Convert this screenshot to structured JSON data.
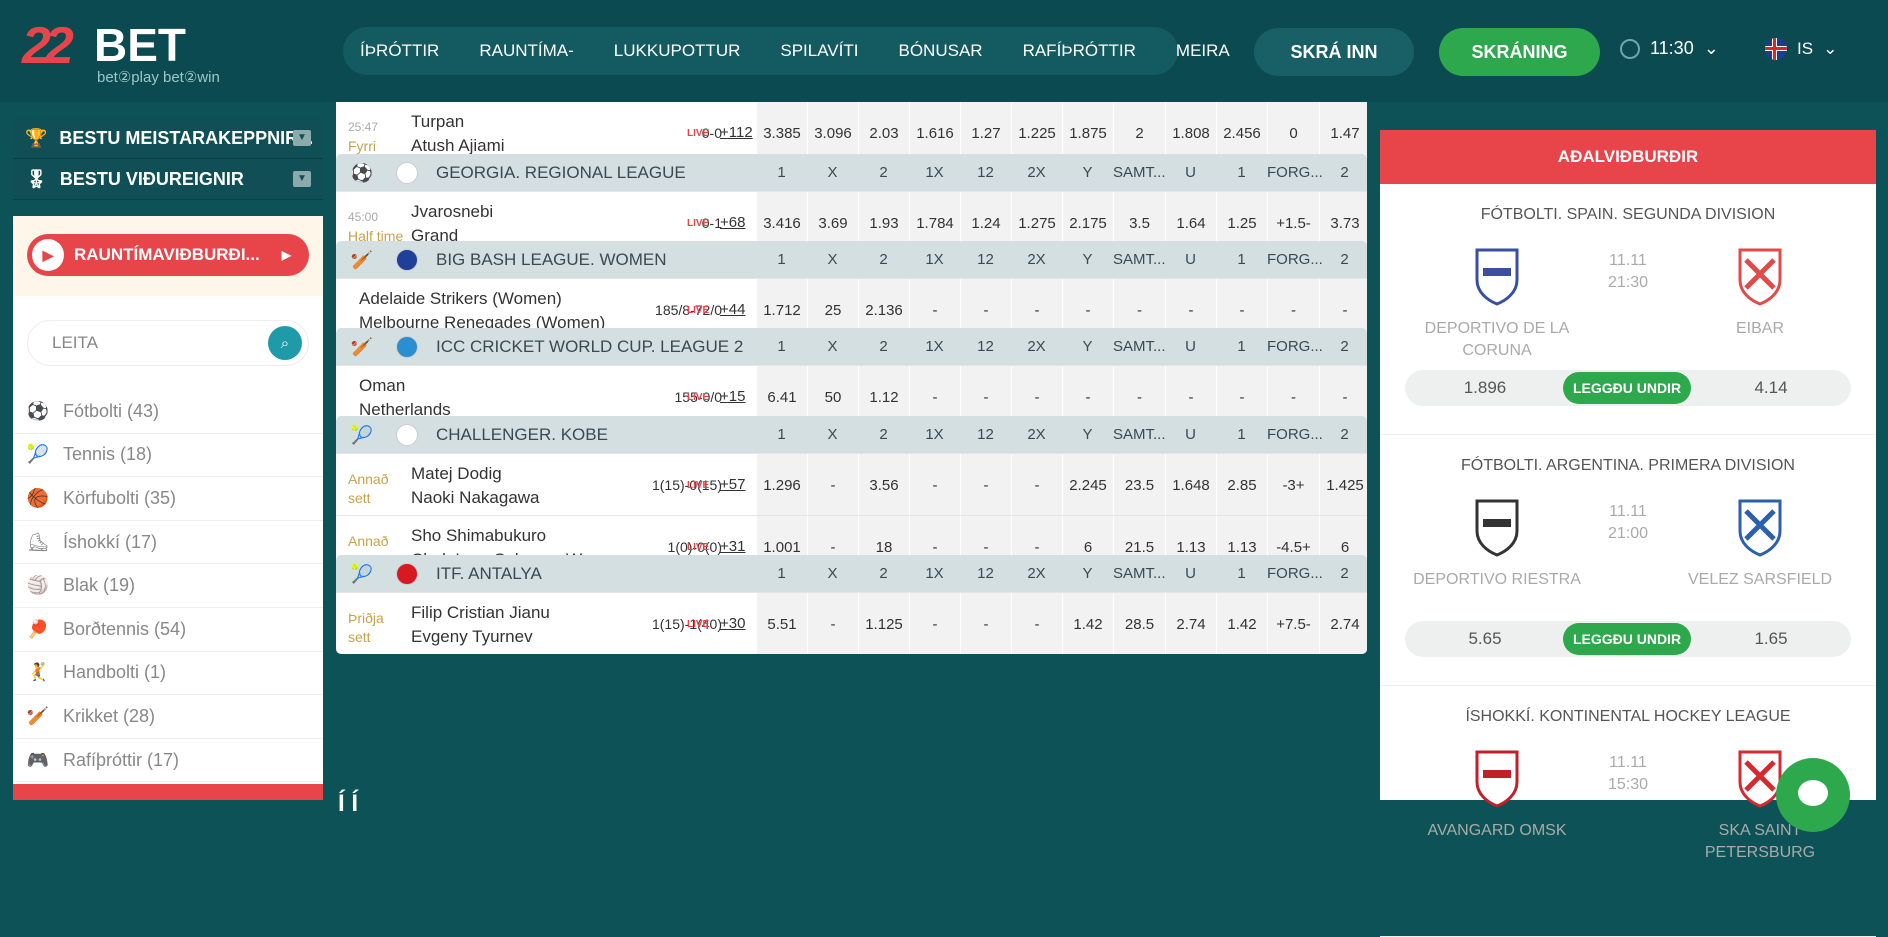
{
  "header": {
    "logo_number": "22",
    "logo_text": "BET",
    "logo_tagline": "bet②play bet②win",
    "nav": [
      "ÍÞRÓTTIR",
      "RAUNTÍMA-",
      "LUKKUPOTTUR",
      "SPILAVÍTI",
      "BÓNUSAR",
      "RAFÍÞRÓTTIR",
      "MEIRA"
    ],
    "login": "SKRÁ INN",
    "register": "SKRÁNING",
    "time": "11:30",
    "language": "IS"
  },
  "sidebar": {
    "top_items": [
      "BESTU MEISTARAKEPPNIR...",
      "BESTU VIÐUREIGNIR"
    ],
    "live_button": "RAUNTÍMAVIÐBURÐI...",
    "search_placeholder": "LEITA",
    "sports": [
      {
        "label": "Fótbolti (43)",
        "icon": "⚽"
      },
      {
        "label": "Tennis (18)",
        "icon": "🎾"
      },
      {
        "label": "Körfubolti (35)",
        "icon": "🏀"
      },
      {
        "label": "Íshokkí (17)",
        "icon": "⛸"
      },
      {
        "label": "Blak (19)",
        "icon": "🏐"
      },
      {
        "label": "Borðtennis (54)",
        "icon": "🏓"
      },
      {
        "label": "Handbolti (1)",
        "icon": "🤾"
      },
      {
        "label": "Krikket (28)",
        "icon": "🏏"
      },
      {
        "label": "Rafíþróttir (17)",
        "icon": "🎮"
      }
    ]
  },
  "columns": [
    "1",
    "X",
    "2",
    "1X",
    "12",
    "2X",
    "Y",
    "SAMT...",
    "U",
    "1",
    "FORG...",
    "2"
  ],
  "top_match": {
    "time": "25:47",
    "status": "Fyrri hálfleikur",
    "team1": "Turpan",
    "team2": "Atush Ajiami",
    "score": "0-0",
    "live": "LIVE",
    "more": "+112",
    "odds": [
      "3.385",
      "3.096",
      "2.03",
      "1.616",
      "1.27",
      "1.225",
      "1.875",
      "2",
      "1.808",
      "2.456",
      "0",
      "1.47"
    ]
  },
  "leagues": [
    {
      "name": "GEORGIA. REGIONAL LEAGUE",
      "matches": [
        {
          "time": "45:00",
          "status": "Half time",
          "team1": "Jvarosnebi",
          "team2": "Grand",
          "score": "0-1",
          "live": "LIVE",
          "more": "+68",
          "odds": [
            "3.416",
            "3.69",
            "1.93",
            "1.784",
            "1.24",
            "1.275",
            "2.175",
            "3.5",
            "1.64",
            "1.25",
            "+1.5-",
            "3.73"
          ]
        }
      ]
    },
    {
      "name": "BIG BASH LEAGUE. WOMEN",
      "matches": [
        {
          "time": "",
          "status": "",
          "team1": "Adelaide Strikers (Women)",
          "team2": "Melbourne Renegades (Women)",
          "score": "185/8-72/0",
          "live": "LIVE",
          "more": "+44",
          "odds": [
            "1.712",
            "25",
            "2.136",
            "-",
            "-",
            "-",
            "-",
            "-",
            "-",
            "-",
            "-",
            "-"
          ]
        }
      ]
    },
    {
      "name": "ICC CRICKET WORLD CUP. LEAGUE 2",
      "matches": [
        {
          "time": "",
          "status": "",
          "team1": "Oman",
          "team2": "Netherlands",
          "score": "155-0/0",
          "live": "LIVE",
          "more": "+15",
          "odds": [
            "6.41",
            "50",
            "1.12",
            "-",
            "-",
            "-",
            "-",
            "-",
            "-",
            "-",
            "-",
            "-"
          ]
        }
      ]
    },
    {
      "name": "CHALLENGER. KOBE",
      "matches": [
        {
          "time": "",
          "status": "Annað sett",
          "team1": "Matej Dodig",
          "team2": "Naoki Nakagawa",
          "score": "1(15)-0(15)",
          "live": "LIVE",
          "more": "+57",
          "odds": [
            "1.296",
            "-",
            "3.56",
            "-",
            "-",
            "-",
            "2.245",
            "23.5",
            "1.648",
            "2.85",
            "-3+",
            "1.425"
          ]
        },
        {
          "time": "",
          "status": "Annað sett",
          "team1": "Sho Shimabukuro",
          "team2": "Chak Lam Coleman Wong",
          "score": "1(0)-0(0)",
          "live": "LIVE",
          "more": "+31",
          "odds": [
            "1.001",
            "-",
            "18",
            "-",
            "-",
            "-",
            "6",
            "21.5",
            "1.13",
            "1.13",
            "-4.5+",
            "6"
          ]
        }
      ]
    },
    {
      "name": "ITF. ANTALYA",
      "matches": [
        {
          "time": "",
          "status": "Þriðja sett",
          "team1": "Filip Cristian Jianu",
          "team2": "Evgeny Tyurnev",
          "score": "1(15)-1(40)",
          "live": "LIVE",
          "more": "+30",
          "odds": [
            "5.51",
            "-",
            "1.125",
            "-",
            "-",
            "-",
            "1.42",
            "28.5",
            "2.74",
            "1.42",
            "+7.5-",
            "2.74"
          ]
        }
      ]
    }
  ],
  "featured": {
    "title": "AÐALVIÐBURÐIR",
    "bet_label": "LEGGÐU UNDIR",
    "events": [
      {
        "league": "FÓTBOLTI. SPAIN. SEGUNDA DIVISION",
        "date": "11.11",
        "time": "21:30",
        "team1": "DEPORTIVO DE LA CORUNA",
        "team2": "EIBAR",
        "odd1": "1.896",
        "odd2": "4.14"
      },
      {
        "league": "FÓTBOLTI. ARGENTINA. PRIMERA DIVISION",
        "date": "11.11",
        "time": "21:00",
        "team1": "DEPORTIVO RIESTRA",
        "team2": "VELEZ SARSFIELD",
        "odd1": "5.65",
        "odd2": "1.65"
      },
      {
        "league": "ÍSHOKKÍ. KONTINENTAL HOCKEY LEAGUE",
        "date": "11.11",
        "time": "15:30",
        "team1": "AVANGARD OMSK",
        "team2": "SKA SAINT PETERSBURG",
        "odd1": "",
        "odd2": ""
      }
    ]
  }
}
